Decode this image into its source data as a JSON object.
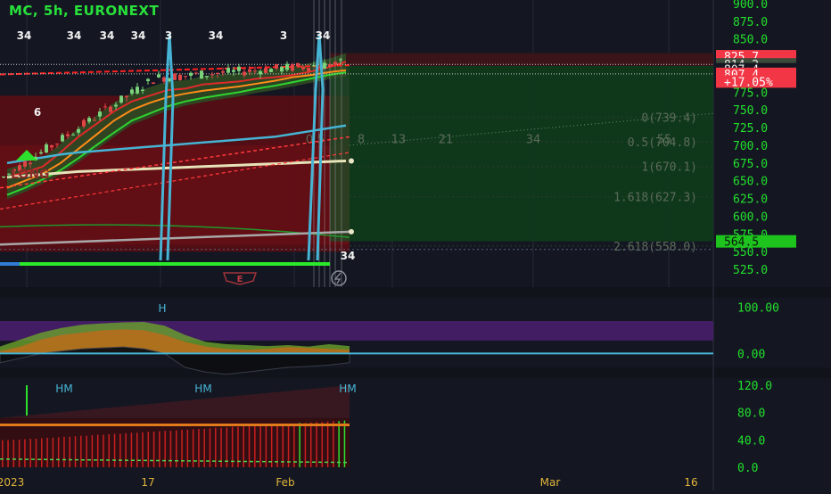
{
  "title": "MC, 5h, EURONEXT",
  "colors": {
    "background": "#141722",
    "panel_divider": "#2a2e3a",
    "axis_text": "#22e02c",
    "price_label_red": "#f23645",
    "price_label_green": "#1ec31e",
    "price_label_dark": "#d8d8d8",
    "fib_text": "#5c6b5a",
    "cyan_line": "#46b4d4",
    "guide_line": "#a9aeb9"
  },
  "chart_data": [
    {
      "type": "line",
      "panel": "price",
      "title": "MC, 5h, EURONEXT",
      "ylim": [
        515,
        900
      ],
      "y_ticks": [
        "900.0",
        "875.0",
        "850.0",
        "825.0",
        "800.0",
        "775.0",
        "750.0",
        "725.0",
        "700.0",
        "675.0",
        "650.0",
        "625.0",
        "600.0",
        "575.0",
        "550.0",
        "525.0"
      ],
      "price_labels": [
        {
          "text": "825.7",
          "value": 825.7,
          "style": "red"
        },
        {
          "text": "814.2",
          "value": 814.2,
          "style": "dark"
        },
        {
          "text": "807.4",
          "value": 807.4,
          "style": "white"
        },
        {
          "text": "807.4",
          "value": 800.8,
          "style": "red"
        },
        {
          "text": "+17.05%",
          "value": 790.0,
          "style": "red"
        },
        {
          "text": "564.5",
          "value": 564.5,
          "style": "green"
        }
      ],
      "fib_levels": [
        {
          "label": "0(739.4)",
          "value": 739.4
        },
        {
          "label": "0.5(704.8)",
          "value": 704.8
        },
        {
          "label": "1(670.1)",
          "value": 670.1
        },
        {
          "label": "1.618(627.3)",
          "value": 627.3
        },
        {
          "label": "2.618(558.0)",
          "value": 558.0
        }
      ],
      "fib_time_labels": [
        "0",
        "5",
        "8",
        "13",
        "21",
        "34",
        "55"
      ],
      "signal_labels": [
        "34",
        "34",
        "34",
        "34",
        "3",
        "34",
        "3",
        "34",
        "6",
        "34"
      ],
      "annotations": [
        "LONG"
      ],
      "series": [
        {
          "values": [
            655,
            662,
            670,
            690,
            712,
            730,
            748,
            762,
            770,
            778,
            780,
            786,
            788,
            790,
            794,
            796,
            799,
            804,
            810,
            818
          ]
        },
        {
          "values": [
            640,
            650,
            660,
            675,
            695,
            715,
            735,
            750,
            760,
            768,
            773,
            777,
            780,
            783,
            787,
            791,
            796,
            799,
            803,
            806
          ]
        },
        {
          "values": [
            630,
            640,
            652,
            665,
            682,
            700,
            718,
            735,
            745,
            755,
            762,
            767,
            771,
            775,
            780,
            784,
            789,
            794,
            799,
            803
          ]
        },
        {
          "values": [
            675,
            679,
            683,
            687,
            690,
            692,
            694,
            696,
            698,
            700,
            702,
            704,
            706,
            708,
            710,
            712,
            716,
            720,
            724,
            728
          ]
        },
        {
          "values": [
            655,
            657,
            659,
            661,
            663,
            664,
            665,
            666,
            667,
            668,
            669,
            670,
            671,
            672,
            673,
            674,
            675,
            676,
            677,
            678
          ]
        }
      ]
    },
    {
      "type": "area",
      "panel": "oscillator",
      "y_ticks": [
        "100.00",
        "0.00"
      ],
      "ylim": [
        -30,
        120
      ],
      "markers": [
        "H"
      ],
      "series": [
        {
          "values": [
            15,
            30,
            45,
            55,
            62,
            65,
            67,
            68,
            60,
            40,
            25,
            20,
            18,
            16,
            18,
            15,
            20,
            16
          ]
        },
        {
          "values": [
            5,
            15,
            30,
            40,
            45,
            50,
            52,
            50,
            40,
            25,
            15,
            10,
            8,
            10,
            14,
            12,
            10,
            8
          ]
        },
        {
          "values": [
            -20,
            -10,
            0,
            5,
            10,
            12,
            14,
            10,
            0,
            -30,
            -40,
            -45,
            -40,
            -35,
            -30,
            -28,
            -25,
            -20
          ]
        }
      ]
    },
    {
      "type": "bar",
      "panel": "volume",
      "y_ticks": [
        "120.0",
        "80.0",
        "40.0",
        "0.0"
      ],
      "ylim": [
        0,
        120
      ],
      "markers": [
        "HM",
        "HM",
        "HM"
      ],
      "series": [
        {
          "values": [
            55,
            55,
            56,
            56,
            57,
            58,
            58,
            59,
            60,
            60,
            61,
            62,
            62,
            63,
            64,
            64,
            65,
            66,
            66,
            67,
            68,
            68,
            69,
            70,
            70,
            71,
            72,
            72,
            73,
            74,
            74,
            75,
            76,
            76,
            77,
            78,
            78,
            79,
            80,
            80,
            81,
            82,
            82,
            83,
            84,
            84,
            85,
            86,
            86,
            87,
            88,
            88,
            89,
            90,
            90,
            91,
            92,
            92,
            93,
            94,
            94,
            95
          ]
        }
      ]
    },
    {
      "type": "line",
      "panel": "time-axis",
      "x_ticks": [
        "2023",
        "17",
        "Feb",
        "Mar",
        "16"
      ]
    }
  ]
}
